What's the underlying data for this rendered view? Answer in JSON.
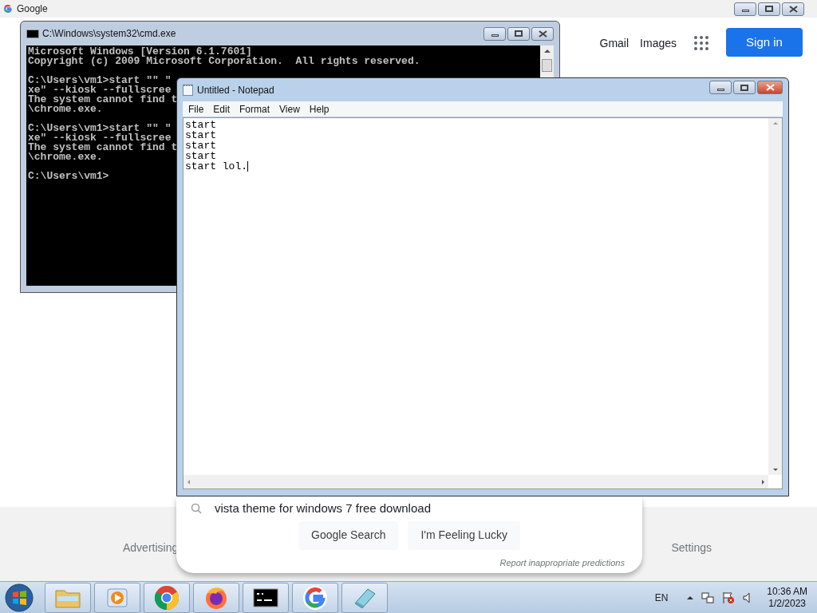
{
  "browser": {
    "tab_title": "Google",
    "header_links": [
      "Gmail",
      "Images"
    ],
    "sign_in": "Sign in",
    "suggestion": "vista theme for windows 7 free download",
    "buttons": [
      "Google Search",
      "I'm Feeling Lucky"
    ],
    "report_link": "Report inappropriate predictions",
    "footer_links": [
      "Advertising",
      "Settings"
    ]
  },
  "cmd": {
    "title": "C:\\Windows\\system32\\cmd.exe",
    "blocks": [
      [
        "Microsoft Windows [Version 6.1.7601]",
        "Copyright (c) 2009 Microsoft Corporation.  All rights reserved."
      ],
      [
        "C:\\Users\\vm1>start \"\" \"",
        "xe\" --kiosk --fullscree",
        "The system cannot find t",
        "\\chrome.exe."
      ],
      [
        "C:\\Users\\vm1>start \"\" \"",
        "xe\" --kiosk --fullscree",
        "The system cannot find t",
        "\\chrome.exe."
      ],
      [
        "C:\\Users\\vm1>"
      ]
    ]
  },
  "notepad": {
    "title": "Untitled - Notepad",
    "menu": [
      "File",
      "Edit",
      "Format",
      "View",
      "Help"
    ],
    "lines": [
      "start",
      "start",
      "start",
      "start",
      "start lol."
    ]
  },
  "taskbar": {
    "language": "EN",
    "time": "10:36 AM",
    "date": "1/2/2023"
  }
}
